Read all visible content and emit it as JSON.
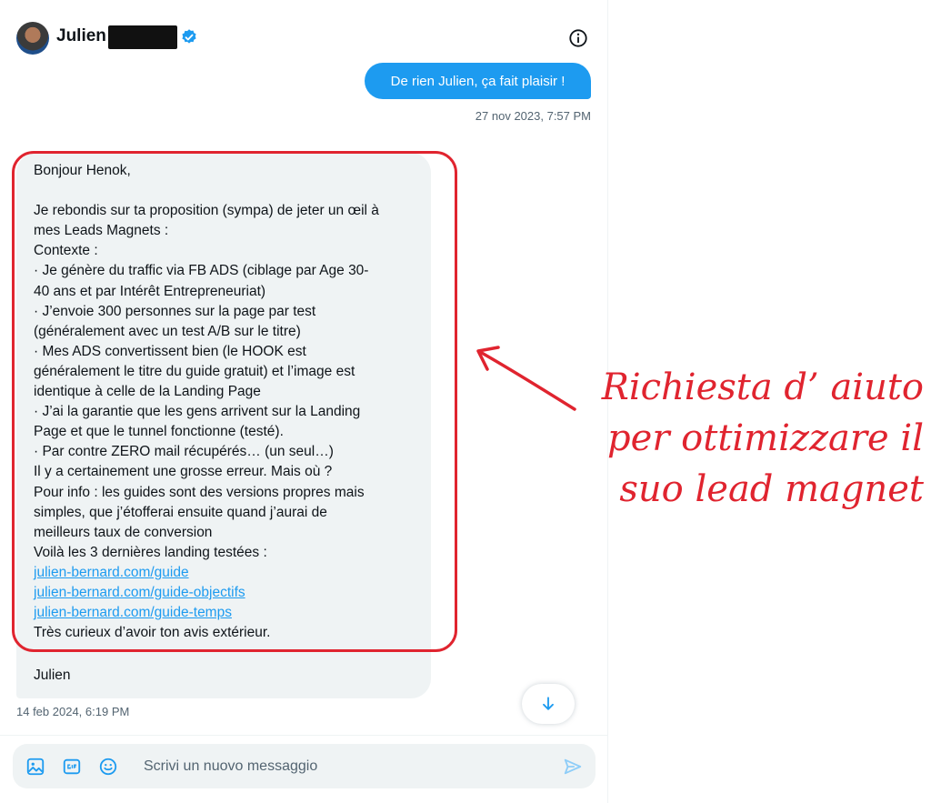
{
  "header": {
    "user_name": "Julien"
  },
  "outgoing": {
    "text": "De rien Julien, ça fait plaisir !",
    "timestamp": "27 nov 2023, 7:57 PM"
  },
  "incoming": {
    "lines": [
      "Bonjour Henok,",
      "",
      "Je rebondis sur ta proposition (sympa) de jeter un œil à",
      "mes Leads Magnets :",
      "Contexte :",
      "· Je génère du traffic via FB ADS (ciblage par Age 30-",
      "40 ans et par Intérêt Entrepreneuriat)",
      "· J’envoie 300 personnes sur la page par test",
      "(généralement avec un test A/B sur le titre)",
      "· Mes ADS convertissent bien (le HOOK est",
      "généralement le titre du guide gratuit) et l’image est",
      "identique à celle de la Landing Page",
      "· J’ai la garantie que les gens arrivent sur la Landing",
      "Page et que le tunnel fonctionne (testé).",
      "· Par contre ZERO mail récupérés… (un seul…)",
      "Il y a certainement une grosse erreur. Mais où ?",
      "Pour info : les guides sont des versions propres mais",
      "simples, que j’étofferai ensuite quand j’aurai de",
      "meilleurs taux de conversion",
      "Voilà les 3 dernières landing testées :"
    ],
    "links": [
      "julien-bernard.com/guide",
      "julien-bernard.com/guide-objectifs",
      "julien-bernard.com/guide-temps"
    ],
    "closing": "Très curieux d’avoir ton avis extérieur.",
    "signature": "Julien",
    "timestamp": "14 feb 2024, 6:19 PM"
  },
  "composer": {
    "placeholder": "Scrivi un nuovo messaggio",
    "value": ""
  },
  "annotation": {
    "lines": [
      "Richiesta d’ aiuto",
      "per ottimizzare il",
      "suo lead magnet"
    ],
    "color": "#e0242f"
  },
  "colors": {
    "accent": "#1d9bf0",
    "bubble_in": "#eff3f4",
    "annotation": "#e0242f"
  },
  "icons": {
    "verified": "verified-badge-icon",
    "info": "info-icon",
    "scroll": "arrow-down-icon",
    "media": "image-icon",
    "gif": "gif-icon",
    "emoji": "emoji-icon",
    "send": "send-icon"
  }
}
